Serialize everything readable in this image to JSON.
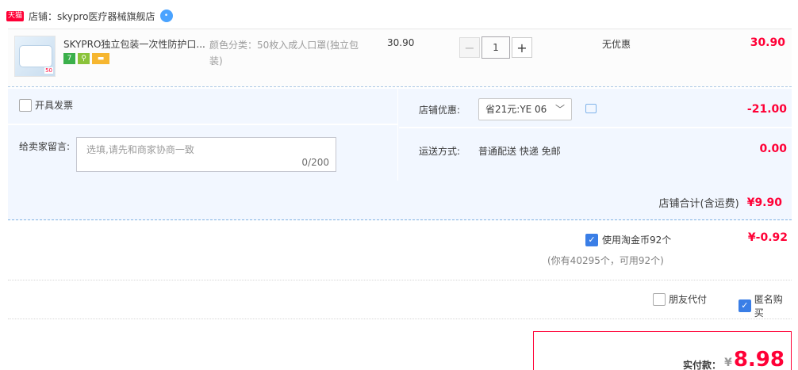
{
  "shop": {
    "badge": "天猫",
    "name": "店铺：skypro医疗器械旗舰店"
  },
  "item": {
    "thumb_tag": "50",
    "title": "SKYPRO独立包装一次性防护口...",
    "sku": "颜色分类：50枚入成人口罩(独立包装)",
    "price": "30.90",
    "qty_minus": "−",
    "qty": "1",
    "qty_plus": "+",
    "discount": "无优惠",
    "subtotal": "30.90",
    "service_icons": [
      "seven-day-return-icon",
      "guarantee-icon",
      "card-payment-icon"
    ]
  },
  "order": {
    "invoice_label": "开具发票",
    "memo_label": "给卖家留言:",
    "memo_placeholder": "选填,请先和商家协商一致",
    "memo_count": "0/200",
    "coupon_label": "店铺优惠:",
    "coupon_selected": "省21元:YE 06",
    "coupon_value": "-21.00",
    "shipping_label": "运送方式:",
    "shipping_text": "普通配送 快递 免邮",
    "shipping_value": "0.00",
    "shop_total_label": "店铺合计(含运费)",
    "shop_total_value": "¥9.90"
  },
  "coins": {
    "label": "使用淘金币92个",
    "note": "(你有40295个，可用92个)",
    "value": "¥-0.92",
    "checked": true
  },
  "options": {
    "friend_pay": "朋友代付",
    "anonymous": "匿名购买",
    "anonymous_checked": true
  },
  "payment": {
    "label": "实付款：",
    "currency": "¥",
    "value": "8.98"
  },
  "colors": {
    "accent": "#ff0036",
    "panel": "#f2f7ff",
    "check": "#3a7ee6"
  }
}
